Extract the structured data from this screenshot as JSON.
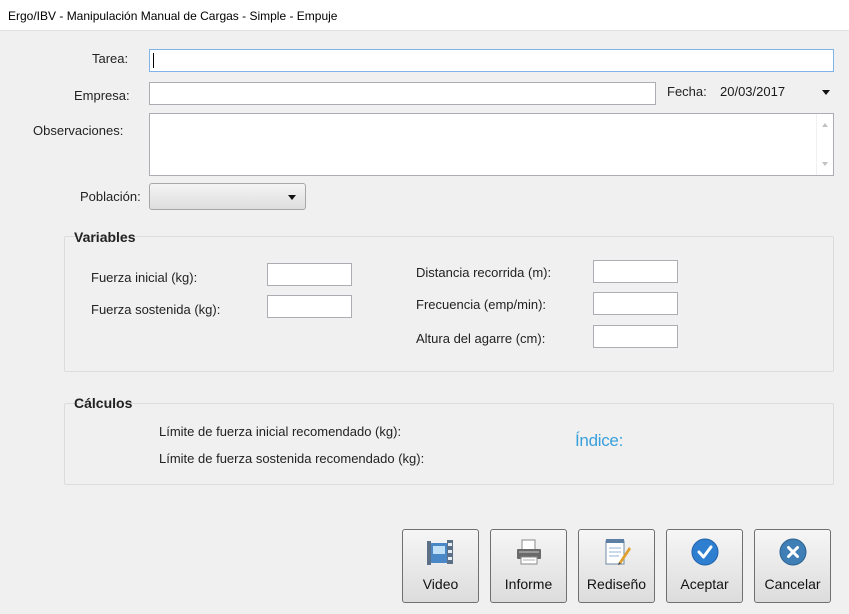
{
  "window": {
    "title": "Ergo/IBV - Manipulación Manual de Cargas - Simple - Empuje"
  },
  "form": {
    "tarea_label": "Tarea:",
    "tarea_value": "",
    "empresa_label": "Empresa:",
    "empresa_value": "",
    "fecha_label": "Fecha:",
    "fecha_value": "20/03/2017",
    "observaciones_label": "Observaciones:",
    "observaciones_value": "",
    "poblacion_label": "Población:",
    "poblacion_value": ""
  },
  "variables": {
    "title": "Variables",
    "fuerza_inicial_label": "Fuerza inicial (kg):",
    "fuerza_sostenida_label": "Fuerza sostenida (kg):",
    "distancia_label": "Distancia recorrida (m):",
    "frecuencia_label": "Frecuencia (emp/min):",
    "altura_label": "Altura del agarre (cm):"
  },
  "calculos": {
    "title": "Cálculos",
    "limite_inicial_label": "Límite de fuerza inicial recomendado (kg):",
    "limite_sostenida_label": "Límite de fuerza sostenida recomendado (kg):",
    "indice_label": "Índice:"
  },
  "buttons": {
    "video": "Video",
    "informe": "Informe",
    "rediseno": "Rediseño",
    "aceptar": "Aceptar",
    "cancelar": "Cancelar"
  },
  "colors": {
    "indice_text": "#3aa0dc",
    "accept_icon": "#2f7fd0",
    "cancel_icon": "#3f7fb5"
  },
  "icons": {
    "video": "film-camera-icon",
    "informe": "printer-icon",
    "rediseno": "notepad-pencil-icon",
    "aceptar": "checkmark-circle-icon",
    "cancelar": "x-circle-icon"
  }
}
